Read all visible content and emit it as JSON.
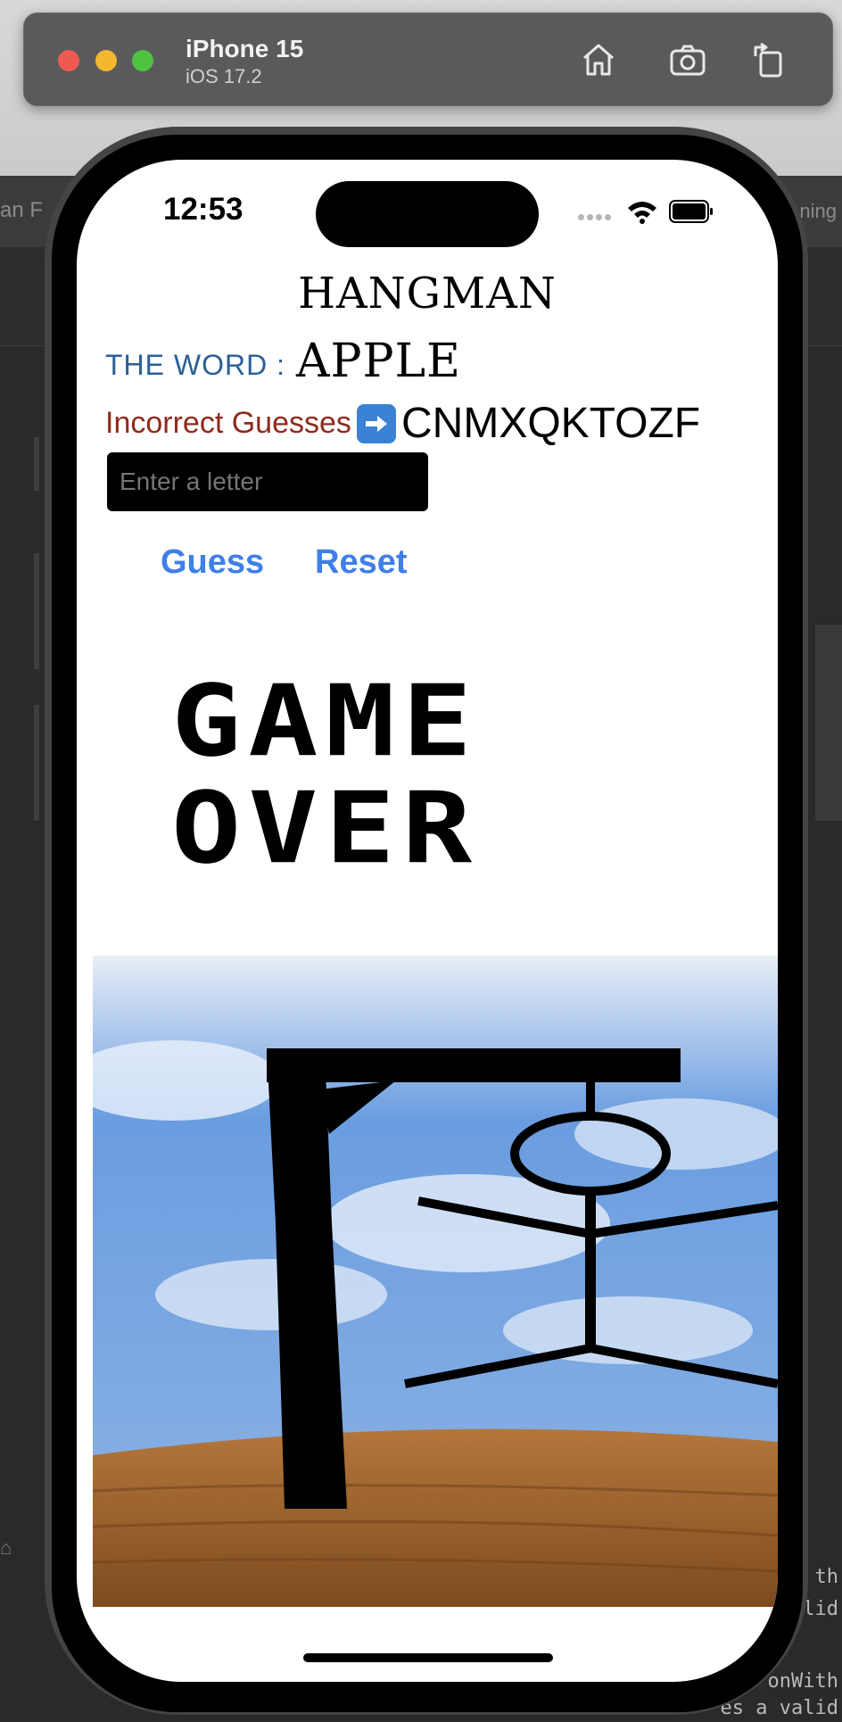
{
  "simulator": {
    "device_name": "iPhone 15",
    "os_version": "iOS 17.2"
  },
  "background": {
    "left_title": "an F",
    "right_title": "ning",
    "code_lines": [
      "th",
      "lid"
    ],
    "code_lines_2": [
      "onWith",
      "es a valid"
    ]
  },
  "status_bar": {
    "time": "12:53"
  },
  "app": {
    "title": "HANGMAN",
    "word_label": "THE WORD :",
    "word_value": "APPLE",
    "incorrect_label": "Incorrect Guesses",
    "incorrect_value": "CNMXQKTOZF",
    "input": {
      "placeholder": "Enter a letter",
      "value": ""
    },
    "guess_button": "Guess",
    "reset_button": "Reset",
    "game_over_line1": "GAME",
    "game_over_line2": "OVER"
  },
  "colors": {
    "word_label": "#2b5f96",
    "incorrect_label": "#8f2a1e",
    "button_text": "#3f7fe9",
    "sky": "#5c8fd6",
    "ground": "#9a5e2a"
  },
  "icons": {
    "home": "home-icon",
    "screenshot": "camera-icon",
    "rotate": "rotate-icon",
    "arrow": "right-arrow-icon"
  }
}
